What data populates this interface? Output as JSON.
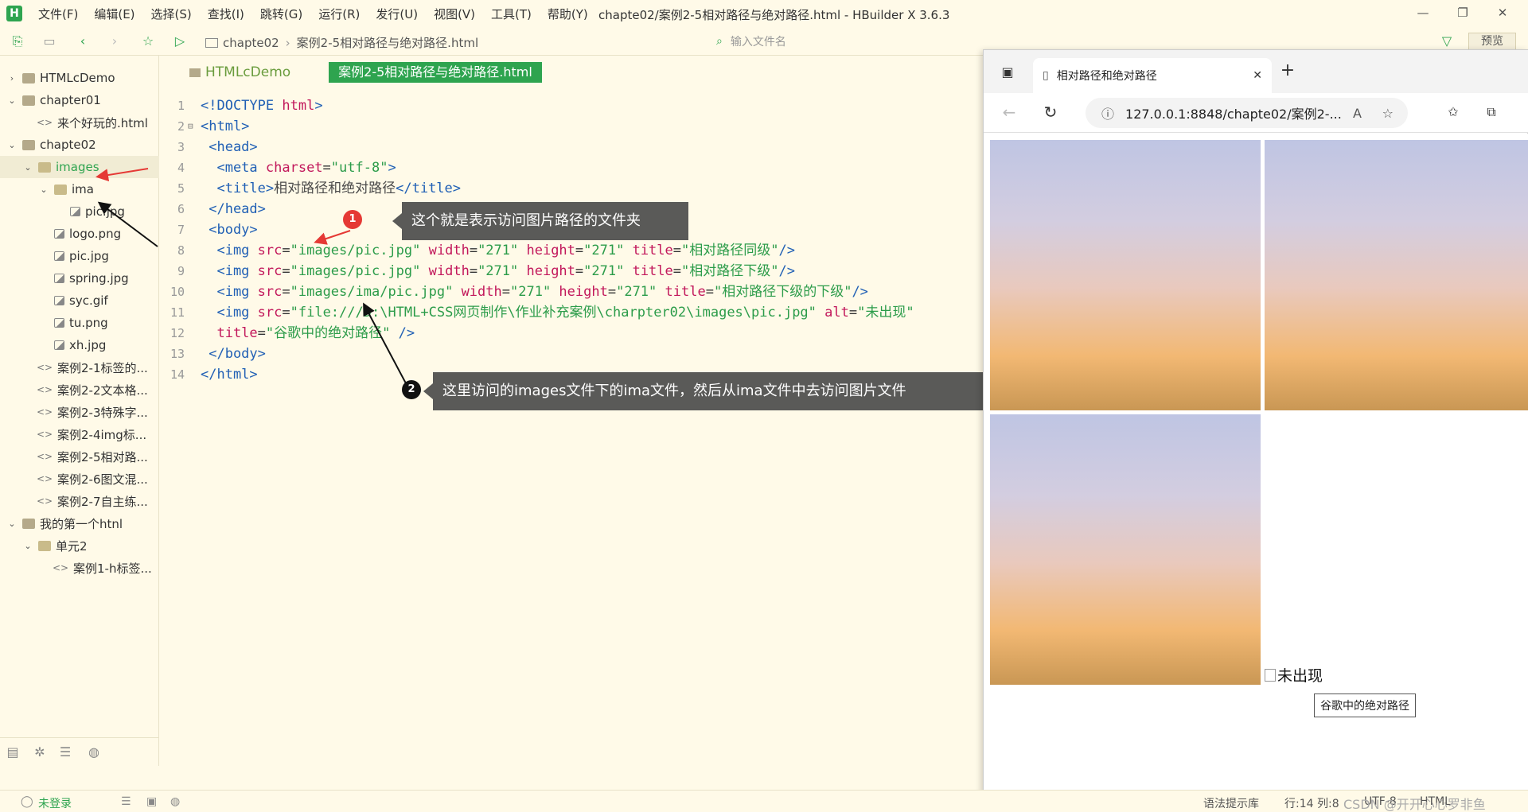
{
  "app": {
    "logo": "H",
    "window_title": "chapte02/案例2-5相对路径与绝对路径.html - HBuilder X 3.6.3"
  },
  "menu": [
    "文件(F)",
    "编辑(E)",
    "选择(S)",
    "查找(I)",
    "跳转(G)",
    "运行(R)",
    "发行(U)",
    "视图(V)",
    "工具(T)",
    "帮助(Y)"
  ],
  "toolbar": {
    "breadcrumb": [
      "chapte02",
      "案例2-5相对路径与绝对路径.html"
    ],
    "file_search_placeholder": "输入文件名",
    "preview_label": "预览"
  },
  "sidebar": {
    "items": [
      {
        "label": "HTMLcDemo",
        "type": "folder",
        "depth": 0,
        "arrow": ">"
      },
      {
        "label": "chapter01",
        "type": "folder",
        "depth": 0,
        "arrow": "v"
      },
      {
        "label": "来个好玩的.html",
        "type": "html",
        "depth": 1,
        "arrow": ""
      },
      {
        "label": "chapte02",
        "type": "folder",
        "depth": 0,
        "arrow": "v"
      },
      {
        "label": "images",
        "type": "folder-open",
        "depth": 1,
        "arrow": "v",
        "selected": true
      },
      {
        "label": "ima",
        "type": "folder-open",
        "depth": 2,
        "arrow": "v"
      },
      {
        "label": "pic.jpg",
        "type": "image",
        "depth": 3,
        "arrow": ""
      },
      {
        "label": "logo.png",
        "type": "image",
        "depth": 2,
        "arrow": ""
      },
      {
        "label": "pic.jpg",
        "type": "image",
        "depth": 2,
        "arrow": ""
      },
      {
        "label": "spring.jpg",
        "type": "image",
        "depth": 2,
        "arrow": ""
      },
      {
        "label": "syc.gif",
        "type": "image",
        "depth": 2,
        "arrow": ""
      },
      {
        "label": "tu.png",
        "type": "image",
        "depth": 2,
        "arrow": ""
      },
      {
        "label": "xh.jpg",
        "type": "image",
        "depth": 2,
        "arrow": ""
      },
      {
        "label": "案例2-1标签的...",
        "type": "html",
        "depth": 1,
        "arrow": ""
      },
      {
        "label": "案例2-2文本格...",
        "type": "html",
        "depth": 1,
        "arrow": ""
      },
      {
        "label": "案例2-3特殊字...",
        "type": "html",
        "depth": 1,
        "arrow": ""
      },
      {
        "label": "案例2-4img标...",
        "type": "html",
        "depth": 1,
        "arrow": ""
      },
      {
        "label": "案例2-5相对路...",
        "type": "html",
        "depth": 1,
        "arrow": ""
      },
      {
        "label": "案例2-6图文混...",
        "type": "html",
        "depth": 1,
        "arrow": ""
      },
      {
        "label": "案例2-7自主练...",
        "type": "html",
        "depth": 1,
        "arrow": ""
      },
      {
        "label": "我的第一个htnl",
        "type": "folder",
        "depth": 0,
        "arrow": "v"
      },
      {
        "label": "单元2",
        "type": "folder-open",
        "depth": 1,
        "arrow": "v"
      },
      {
        "label": "案例1-h标签...",
        "type": "html",
        "depth": 2,
        "arrow": ""
      }
    ]
  },
  "editor": {
    "project_tab": "HTMLcDemo",
    "active_tab": "案例2-5相对路径与绝对路径.html",
    "lines": [
      {
        "n": "1",
        "fold": "",
        "tokens": [
          [
            "t-tag",
            "<!DOCTYPE "
          ],
          [
            "t-attr",
            "html"
          ],
          [
            "t-tag",
            ">"
          ]
        ]
      },
      {
        "n": "2",
        "fold": "⊟",
        "tokens": [
          [
            "t-tag",
            "<html>"
          ]
        ]
      },
      {
        "n": "3",
        "fold": "",
        "tokens": [
          [
            "t-tag",
            " <head>"
          ]
        ]
      },
      {
        "n": "4",
        "fold": "",
        "tokens": [
          [
            "t-tag",
            "  <meta "
          ],
          [
            "t-attr",
            "charset"
          ],
          [
            "t-eq",
            "="
          ],
          [
            "t-str",
            "\"utf-8\""
          ],
          [
            "t-tag",
            ">"
          ]
        ]
      },
      {
        "n": "5",
        "fold": "",
        "tokens": [
          [
            "t-tag",
            "  <title>"
          ],
          [
            "t-text",
            "相对路径和绝对路径"
          ],
          [
            "t-tag",
            "</title>"
          ]
        ]
      },
      {
        "n": "6",
        "fold": "",
        "tokens": [
          [
            "t-tag",
            " </head>"
          ]
        ]
      },
      {
        "n": "7",
        "fold": "",
        "tokens": [
          [
            "t-tag",
            " <body>"
          ]
        ]
      },
      {
        "n": "8",
        "fold": "",
        "tokens": [
          [
            "t-tag",
            "  <img "
          ],
          [
            "t-attr",
            "src"
          ],
          [
            "t-eq",
            "="
          ],
          [
            "t-str",
            "\"images/pic.jpg\""
          ],
          [
            "t-attr",
            " width"
          ],
          [
            "t-eq",
            "="
          ],
          [
            "t-str",
            "\"271\""
          ],
          [
            "t-attr",
            " height"
          ],
          [
            "t-eq",
            "="
          ],
          [
            "t-str",
            "\"271\""
          ],
          [
            "t-attr",
            " title"
          ],
          [
            "t-eq",
            "="
          ],
          [
            "t-str",
            "\"相对路径同级\""
          ],
          [
            "t-tag",
            "/>"
          ]
        ]
      },
      {
        "n": "9",
        "fold": "",
        "tokens": [
          [
            "t-tag",
            "  <img "
          ],
          [
            "t-attr",
            "src"
          ],
          [
            "t-eq",
            "="
          ],
          [
            "t-str",
            "\"images/pic.jpg\""
          ],
          [
            "t-attr",
            " width"
          ],
          [
            "t-eq",
            "="
          ],
          [
            "t-str",
            "\"271\""
          ],
          [
            "t-attr",
            " height"
          ],
          [
            "t-eq",
            "="
          ],
          [
            "t-str",
            "\"271\""
          ],
          [
            "t-attr",
            " title"
          ],
          [
            "t-eq",
            "="
          ],
          [
            "t-str",
            "\"相对路径下级\""
          ],
          [
            "t-tag",
            "/>"
          ]
        ]
      },
      {
        "n": "10",
        "fold": "",
        "tokens": [
          [
            "t-tag",
            "  <img "
          ],
          [
            "t-attr",
            "src"
          ],
          [
            "t-eq",
            "="
          ],
          [
            "t-str",
            "\"images/ima/pic.jpg\""
          ],
          [
            "t-attr",
            " width"
          ],
          [
            "t-eq",
            "="
          ],
          [
            "t-str",
            "\"271\""
          ],
          [
            "t-attr",
            " height"
          ],
          [
            "t-eq",
            "="
          ],
          [
            "t-str",
            "\"271\""
          ],
          [
            "t-attr",
            " title"
          ],
          [
            "t-eq",
            "="
          ],
          [
            "t-str",
            "\"相对路径下级的下级\""
          ],
          [
            "t-tag",
            "/>"
          ]
        ]
      },
      {
        "n": "11",
        "fold": "",
        "tokens": [
          [
            "t-tag",
            "  <img "
          ],
          [
            "t-attr",
            "src"
          ],
          [
            "t-eq",
            "="
          ],
          [
            "t-str",
            "\"file:///D:\\HTML+CSS网页制作\\作业补充案例\\charpter02\\images\\pic.jpg\""
          ],
          [
            "t-attr",
            " alt"
          ],
          [
            "t-eq",
            "="
          ],
          [
            "t-str",
            "\"未出现\""
          ]
        ]
      },
      {
        "n": "12",
        "fold": "",
        "tokens": [
          [
            "t-attr",
            "  title"
          ],
          [
            "t-eq",
            "="
          ],
          [
            "t-str",
            "\"谷歌中的绝对路径\""
          ],
          [
            "t-tag",
            " />"
          ]
        ]
      },
      {
        "n": "13",
        "fold": "",
        "tokens": [
          [
            "t-tag",
            " </body>"
          ]
        ]
      },
      {
        "n": "14",
        "fold": "",
        "tokens": [
          [
            "t-tag",
            "</html>"
          ]
        ]
      }
    ]
  },
  "annotations": {
    "a1_num": "1",
    "a1_text": "这个就是表示访问图片路径的文件夹",
    "a2_num": "2",
    "a2_text": "这里访问的images文件下的ima文件，然后从ima文件中去访问图片文件",
    "a1_color": "#e53935",
    "a2_color": "#111111"
  },
  "browser": {
    "tab_title": "相对路径和绝对路径",
    "url": "127.0.0.1:8848/chapte02/案例2-...",
    "broken_alt": "未出现",
    "tooltip": "谷歌中的绝对路径"
  },
  "statusbar": {
    "login": "未登录",
    "syntax": "语法提示库",
    "position": "行:14  列:8",
    "encoding": "UTF-8",
    "lang": "HTML",
    "watermark": "CSDN @开开心心罗非鱼"
  },
  "colors": {
    "accent": "#2ea44f",
    "background": "#fffae8"
  }
}
